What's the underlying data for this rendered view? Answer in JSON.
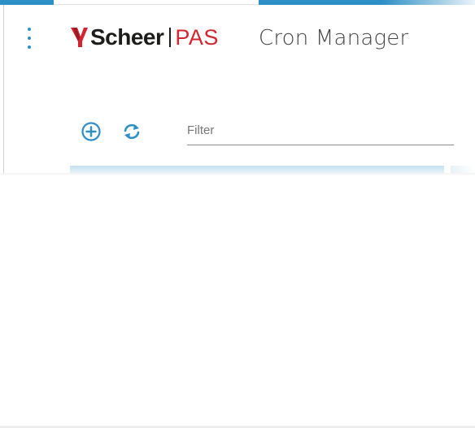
{
  "app": {
    "brand_name": "Scheer",
    "brand_suffix": "PAS",
    "title": "Cron Manager",
    "accent_color": "#2e8fc6",
    "brand_red": "#d1252f"
  },
  "toolbar": {
    "menu_icon": "more-vertical-icon",
    "add_icon": "add-circle-icon",
    "refresh_icon": "refresh-icon"
  },
  "filter": {
    "placeholder": "Filter",
    "value": ""
  }
}
